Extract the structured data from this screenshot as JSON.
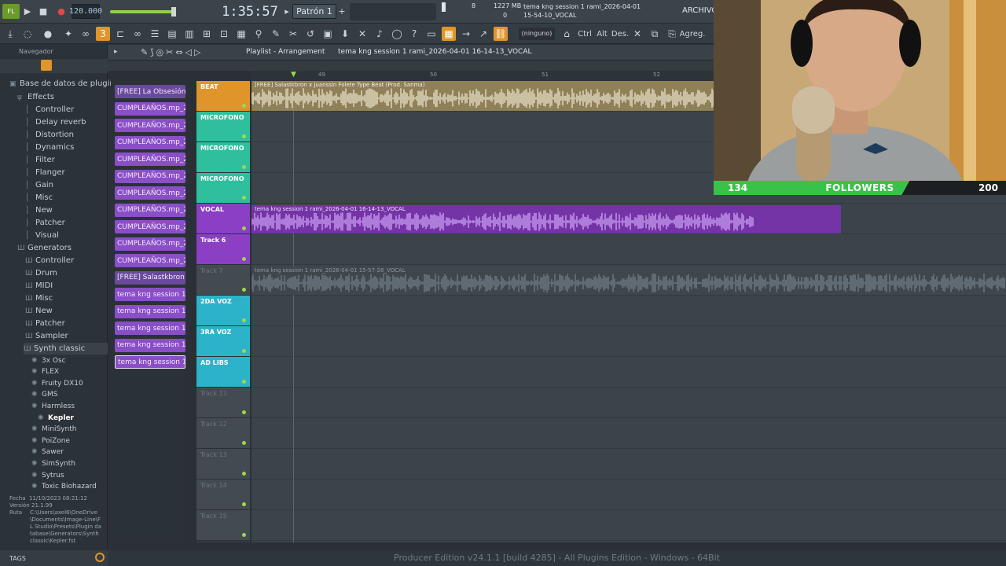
{
  "topbar": {
    "tempo": "120.000",
    "time": "1:35:57",
    "pattern": "Patrón 1",
    "cpu": "8",
    "mem": "1227 MB",
    "polyphony": "0",
    "hint_line1": "tema kng session 1 rami_2026-04-01",
    "hint_line2": "15-54-10_VOCAL",
    "archivo": "ARCHIVO (",
    "none_label": "(ninguno)",
    "btn_ctrl": "Ctrl",
    "btn_alt": "Alt",
    "btn_des": "Des.",
    "btn_agreg": "Agreg."
  },
  "browser": {
    "title": "Navegador",
    "root": "Base de datos de plugins",
    "effects": "Effects",
    "effects_items": [
      "Controller",
      "Delay reverb",
      "Distortion",
      "Dynamics",
      "Filter",
      "Flanger",
      "Gain",
      "Misc",
      "New",
      "Patcher",
      "Visual"
    ],
    "generators": "Generators",
    "gen_items": [
      "Controller",
      "Drum",
      "MIDI",
      "Misc",
      "New",
      "Patcher",
      "Sampler"
    ],
    "synth_classic": "Synth classic",
    "synth_items": [
      "3x Osc",
      "FLEX",
      "Fruity DX10",
      "GMS",
      "Harmless",
      "Kepler",
      "MiniSynth",
      "PoiZone",
      "Sawer",
      "SimSynth",
      "Sytrus",
      "Toxic Biohazard"
    ],
    "info_fecha_label": "Fecha",
    "info_fecha": "11/10/2023 08:21:12",
    "info_version_label": "Versión",
    "info_version": "21.1.99",
    "info_ruta_label": "Ruta",
    "info_ruta": "C:\\Users\\axel6\\OneDrive\\Documents\\Image-Line\\FL Studio\\Presets\\Plugin database\\Generators\\Synth classic\\Kepler.fst",
    "tags": "TAGS"
  },
  "patterns": [
    "[FREE] La Obsesión F...",
    "CUMPLEAÑOS.mp_2026-0...",
    "CUMPLEAÑOS.mp_2026-0...",
    "CUMPLEAÑOS.mp_2026-0...",
    "CUMPLEAÑOS.mp_2026-0...",
    "CUMPLEAÑOS.mp_2026-0...",
    "CUMPLEAÑOS.mp_2026-0...",
    "CUMPLEAÑOS.mp_2026-0...",
    "CUMPLEAÑOS.mp_2026-0...",
    "CUMPLEAÑOS.mp_2026-0...",
    "CUMPLEAÑOS.mp_2026-0...",
    "[FREE] Salastkbron x...",
    "tema kng session 1 rami...",
    "tema kng session 1 rami...",
    "tema kng session 1 rami...",
    "tema kng session 1 rami...",
    "tema kng session 1 rami..."
  ],
  "playlist": {
    "title": "Playlist - Arrangement",
    "breadcrumb": "tema kng session 1 rami_2026-04-01 16-14-13_VOCAL",
    "ruler": [
      "49",
      "50",
      "51",
      "52"
    ],
    "tracks": [
      {
        "name": "BEAT",
        "color": "#e0952a"
      },
      {
        "name": "MICROFONO",
        "color": "#2fbf9f"
      },
      {
        "name": "MICROFONO",
        "color": "#2fbf9f"
      },
      {
        "name": "MICROFONO",
        "color": "#2fbf9f"
      },
      {
        "name": "VOCAL",
        "color": "#8a3fc4"
      },
      {
        "name": "Track 6",
        "color": "#8a3fc4"
      },
      {
        "name": "Track 7",
        "color": "#434b51"
      },
      {
        "name": "2DA VOZ",
        "color": "#2cb3c9"
      },
      {
        "name": "3RA VOZ",
        "color": "#2cb3c9"
      },
      {
        "name": "AD LIBS",
        "color": "#2cb3c9"
      },
      {
        "name": "Track 11",
        "color": "#434b51"
      },
      {
        "name": "Track 12",
        "color": "#434b51"
      },
      {
        "name": "Track 13",
        "color": "#434b51"
      },
      {
        "name": "Track 14",
        "color": "#434b51"
      },
      {
        "name": "Track 15",
        "color": "#434b51"
      }
    ],
    "clip_beat": "[FREE] Salastkbron x Juanssin Folete  Type Beat (Prod. Sanma)",
    "clip_vocal": "tema kng session 1 rami_2026-04-01 16-14-13_VOCAL",
    "clip_vocal2": "tema kng session 1 rami_2026-04-01 15-57-28_VOCAL"
  },
  "status": "Producer Edition v24.1.1 [build 4285] - All Plugins Edition - Windows - 64Bit",
  "followers": {
    "current": "134",
    "title": "FOLLOWERS",
    "goal": "200",
    "progress": 0.67
  }
}
